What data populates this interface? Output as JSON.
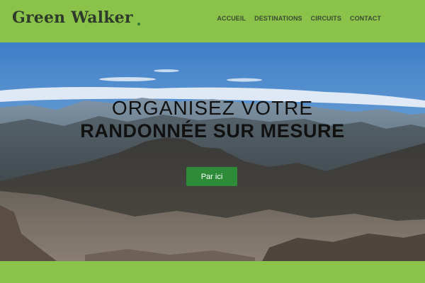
{
  "brand": {
    "name": "Green Walker"
  },
  "nav": {
    "items": [
      {
        "label": "ACCUEIL"
      },
      {
        "label": "DESTINATIONS"
      },
      {
        "label": "CIRCUITS"
      },
      {
        "label": "CONTACT"
      }
    ]
  },
  "hero": {
    "title_line1": "ORGANISEZ VOTRE",
    "title_line2": "RANDONNÉE SUR MESURE",
    "cta_label": "Par ici"
  },
  "colors": {
    "brand_green": "#8bc34a",
    "button_green": "#2e8b38",
    "logo_text": "#2e3b2a"
  }
}
